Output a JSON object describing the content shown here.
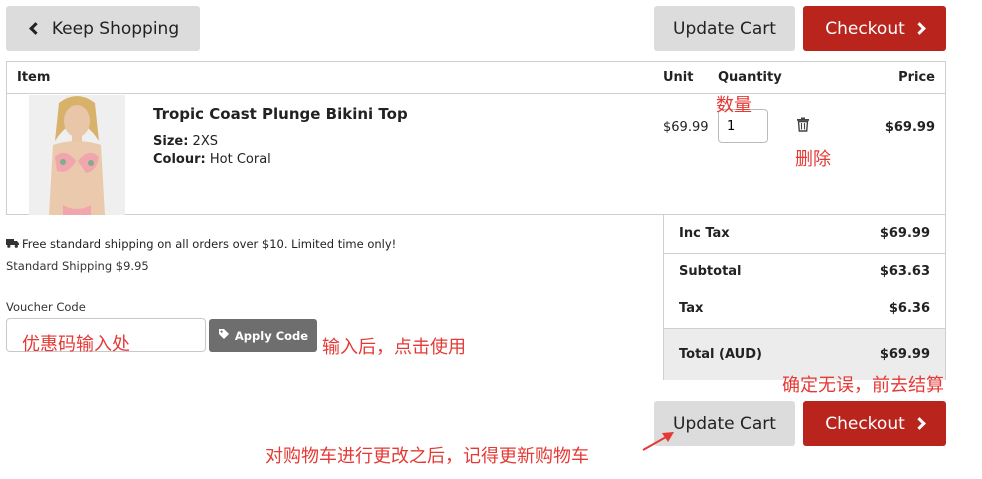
{
  "nav": {
    "keep_shopping": "Keep Shopping",
    "update_cart": "Update Cart",
    "checkout": "Checkout"
  },
  "table": {
    "headers": {
      "item": "Item",
      "unit": "Unit",
      "quantity": "Quantity",
      "price": "Price"
    }
  },
  "product": {
    "name": "Tropic Coast Plunge Bikini Top",
    "size_label": "Size:",
    "size_value": "2XS",
    "colour_label": "Colour:",
    "colour_value": "Hot Coral",
    "unit_price": "$69.99",
    "quantity": "1",
    "line_price": "$69.99"
  },
  "shipping": {
    "free_notice": "Free standard shipping on all orders over $10. Limited time only!",
    "standard": "Standard Shipping $9.95"
  },
  "voucher": {
    "label": "Voucher Code",
    "apply_label": "Apply Code"
  },
  "totals": {
    "inc_tax_label": "Inc Tax",
    "inc_tax_value": "$69.99",
    "subtotal_label": "Subtotal",
    "subtotal_value": "$63.63",
    "tax_label": "Tax",
    "tax_value": "$6.36",
    "total_label": "Total (AUD)",
    "total_value": "$69.99"
  },
  "annotations": {
    "quantity": "数量",
    "delete": "删除",
    "voucher_input": "优惠码输入处",
    "apply": "输入后，点击使用",
    "confirm": "确定无误，前去结算",
    "update_reminder": "对购物车进行更改之后，记得更新购物车"
  },
  "colors": {
    "accent_red": "#b9251d",
    "annotation_red": "#e53935",
    "button_grey": "#dcdcdc",
    "apply_grey": "#6e6e6e"
  },
  "icons": [
    "chevron-left-icon",
    "chevron-right-icon",
    "trash-icon",
    "truck-icon",
    "tag-icon",
    "annotation-arrow-icon"
  ]
}
